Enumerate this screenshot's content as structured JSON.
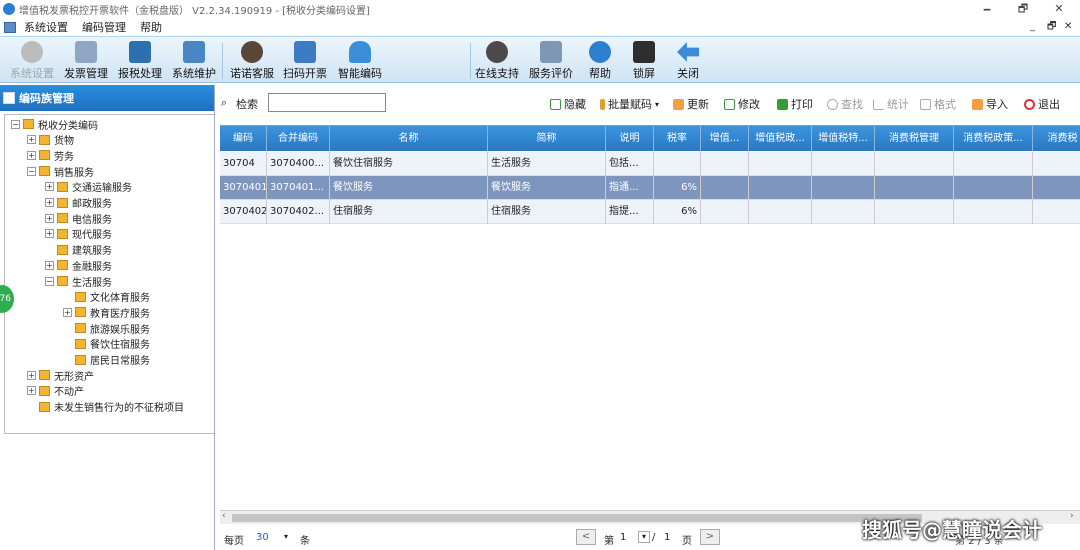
{
  "window": {
    "title": "增值税发票税控开票软件（金税盘版） V2.2.34.190919 - [税收分类编码设置]",
    "minimize": "🗕",
    "restore": "🗗",
    "close": "✕"
  },
  "menubar": {
    "items": [
      "系统设置",
      "编码管理",
      "帮助"
    ],
    "right_controls": [
      "_",
      "🗗",
      "✕"
    ]
  },
  "toolbar": {
    "items": [
      {
        "label": "系统设置",
        "disabled": true,
        "icon": "gear-icon"
      },
      {
        "label": "发票管理",
        "icon": "invoice-icon"
      },
      {
        "label": "报税处理",
        "icon": "monitor-icon"
      },
      {
        "label": "系统维护",
        "icon": "folder-gear-icon"
      },
      {
        "label": "诺诺客服",
        "icon": "agent-icon"
      },
      {
        "label": "扫码开票",
        "icon": "qrcode-icon"
      },
      {
        "label": "智能编码",
        "icon": "cloud-icon"
      },
      {
        "label": "在线支持",
        "icon": "support-icon"
      },
      {
        "label": "服务评价",
        "icon": "review-icon"
      },
      {
        "label": "帮助",
        "icon": "help-icon"
      },
      {
        "label": "锁屏",
        "icon": "lock-screen-icon"
      },
      {
        "label": "关闭",
        "icon": "back-arrow-icon"
      }
    ]
  },
  "left_panel": {
    "title": "编码族管理",
    "badge": "76"
  },
  "tree": [
    {
      "label": "税收分类编码",
      "level": 0,
      "exp": "−"
    },
    {
      "label": "货物",
      "level": 1,
      "exp": "+"
    },
    {
      "label": "劳务",
      "level": 1,
      "exp": "+"
    },
    {
      "label": "销售服务",
      "level": 1,
      "exp": "−"
    },
    {
      "label": "交通运输服务",
      "level": 2,
      "exp": "+"
    },
    {
      "label": "邮政服务",
      "level": 2,
      "exp": "+"
    },
    {
      "label": "电信服务",
      "level": 2,
      "exp": "+"
    },
    {
      "label": "现代服务",
      "level": 2,
      "exp": "+"
    },
    {
      "label": "建筑服务",
      "level": 2,
      "exp": ""
    },
    {
      "label": "金融服务",
      "level": 2,
      "exp": "+"
    },
    {
      "label": "生活服务",
      "level": 2,
      "exp": "−"
    },
    {
      "label": "文化体育服务",
      "level": 3,
      "exp": ""
    },
    {
      "label": "教育医疗服务",
      "level": 3,
      "exp": "+"
    },
    {
      "label": "旅游娱乐服务",
      "level": 3,
      "exp": ""
    },
    {
      "label": "餐饮住宿服务",
      "level": 3,
      "exp": ""
    },
    {
      "label": "居民日常服务",
      "level": 3,
      "exp": ""
    },
    {
      "label": "无形资产",
      "level": 1,
      "exp": "+"
    },
    {
      "label": "不动产",
      "level": 1,
      "exp": "+"
    },
    {
      "label": "未发生销售行为的不征税项目",
      "level": 1,
      "exp": ""
    }
  ],
  "search": {
    "label": "检索",
    "value": ""
  },
  "actions": [
    {
      "label": "隐藏",
      "disabled": false
    },
    {
      "label": "批量赋码",
      "disabled": false
    },
    {
      "label": "更新",
      "disabled": false
    },
    {
      "label": "修改",
      "disabled": false
    },
    {
      "label": "打印",
      "disabled": false
    },
    {
      "label": "查找",
      "disabled": true
    },
    {
      "label": "统计",
      "disabled": true
    },
    {
      "label": "格式",
      "disabled": true
    },
    {
      "label": "导入",
      "disabled": false
    },
    {
      "label": "退出",
      "disabled": false
    }
  ],
  "grid": {
    "columns": [
      "编码",
      "合并编码",
      "名称",
      "简称",
      "说明",
      "税率",
      "增值...",
      "增值税政...",
      "增值税特...",
      "消费税管理",
      "消费税政策...",
      "消费税"
    ],
    "rows": [
      [
        "30704",
        "3070400...",
        "餐饮住宿服务",
        "生活服务",
        "包括...",
        "",
        "",
        "",
        "",
        "",
        "",
        ""
      ],
      [
        "3070401",
        "3070401...",
        "餐饮服务",
        "餐饮服务",
        "指通...",
        "6%",
        "",
        "",
        "",
        "",
        "",
        ""
      ],
      [
        "3070402",
        "3070402...",
        "住宿服务",
        "住宿服务",
        "指提...",
        "6%",
        "",
        "",
        "",
        "",
        "",
        ""
      ]
    ],
    "selected_row": 1
  },
  "pager": {
    "per_page_label": "每页",
    "per_page": "30",
    "per_page_unit": "条",
    "page_prefix": "第",
    "page": "1",
    "page_sep": "/",
    "total_pages": "1",
    "page_suffix": "页",
    "prev": "<",
    "next": ">",
    "right_tail": "第  2 / 3  条"
  },
  "watermark": "搜狐号@慧瞳说会计",
  "colors": {
    "accent": "#2a78c4",
    "selected": "#7e96bd"
  }
}
